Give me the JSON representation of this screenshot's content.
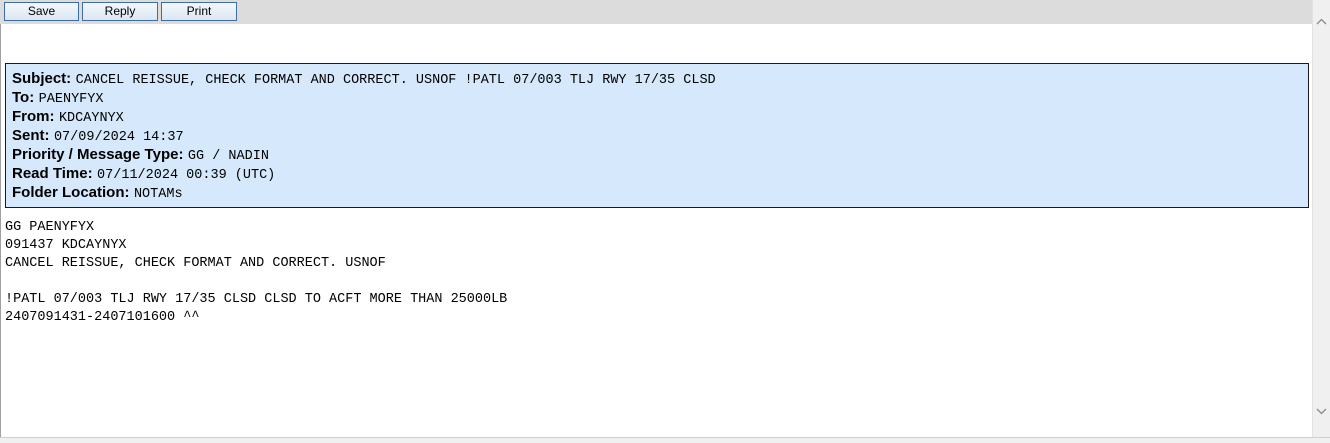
{
  "toolbar": {
    "save_label": "Save",
    "reply_label": "Reply",
    "print_label": "Print"
  },
  "header": {
    "subject_label": "Subject:",
    "subject_value": "CANCEL REISSUE, CHECK FORMAT AND CORRECT. USNOF !PATL 07/003 TLJ RWY 17/35 CLSD",
    "to_label": "To:",
    "to_value": "PAENYFYX",
    "from_label": "From:",
    "from_value": "KDCAYNYX",
    "sent_label": "Sent:",
    "sent_value": "07/09/2024 14:37",
    "priority_label": "Priority / Message Type:",
    "priority_value": "GG / NADIN",
    "read_time_label": "Read Time:",
    "read_time_value": "07/11/2024 00:39 (UTC)",
    "folder_label": "Folder Location:",
    "folder_value": "NOTAMs"
  },
  "message_body": "GG PAENYFYX\n091437 KDCAYNYX\nCANCEL REISSUE, CHECK FORMAT AND CORRECT. USNOF\n\n!PATL 07/003 TLJ RWY 17/35 CLSD CLSD TO ACFT MORE THAN 25000LB\n2407091431-2407101600 ^^",
  "colors": {
    "header_background": "#d6e8fb",
    "toolbar_background": "#dcdcdc",
    "button_border": "#3c6ea5"
  },
  "icons": {
    "scroll_up": "chevron-up-icon",
    "scroll_down": "chevron-down-icon"
  }
}
